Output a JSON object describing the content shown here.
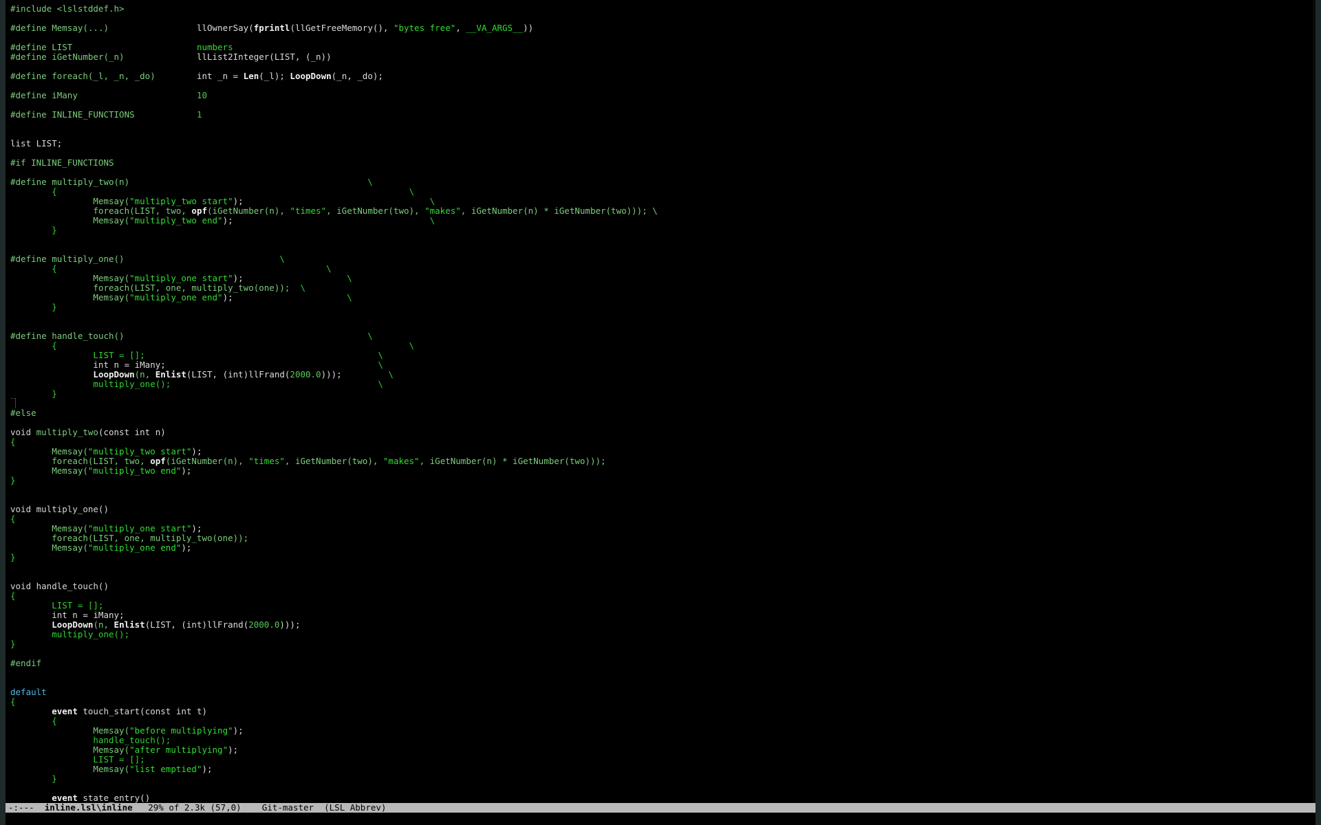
{
  "editor": {
    "lines": [
      [
        {
          "t": "#include <lslstddef.h>",
          "c": "preproc"
        }
      ],
      [],
      [
        {
          "t": "#define ",
          "c": "preproc"
        },
        {
          "t": "Memsay(...)",
          "c": "func"
        },
        {
          "t": "                 ",
          "c": "plain"
        },
        {
          "t": "llOwnerSay(",
          "c": "ident"
        },
        {
          "t": "fprintl",
          "c": "bold"
        },
        {
          "t": "(llGetFreeMemory(), ",
          "c": "ident"
        },
        {
          "t": "\"bytes free\"",
          "c": "string"
        },
        {
          "t": ", ",
          "c": "ident"
        },
        {
          "t": "__VA_ARGS__",
          "c": "string"
        },
        {
          "t": "))",
          "c": "ident"
        }
      ],
      [],
      [
        {
          "t": "#define ",
          "c": "preproc"
        },
        {
          "t": "LIST",
          "c": "func"
        },
        {
          "t": "                        ",
          "c": "plain"
        },
        {
          "t": "numbers",
          "c": "string"
        }
      ],
      [
        {
          "t": "#define ",
          "c": "preproc"
        },
        {
          "t": "iGetNumber(_n)",
          "c": "func"
        },
        {
          "t": "              ",
          "c": "plain"
        },
        {
          "t": "llList2Integer(LIST, (_n))",
          "c": "ident"
        }
      ],
      [],
      [
        {
          "t": "#define ",
          "c": "preproc"
        },
        {
          "t": "foreach(_l, _n, _do)",
          "c": "func"
        },
        {
          "t": "        ",
          "c": "plain"
        },
        {
          "t": "int _n = ",
          "c": "ident"
        },
        {
          "t": "Len",
          "c": "bold"
        },
        {
          "t": "(_l); ",
          "c": "ident"
        },
        {
          "t": "LoopDown",
          "c": "bold"
        },
        {
          "t": "(_n, _do);",
          "c": "ident"
        }
      ],
      [],
      [
        {
          "t": "#define ",
          "c": "preproc"
        },
        {
          "t": "iMany",
          "c": "func"
        },
        {
          "t": "                       ",
          "c": "plain"
        },
        {
          "t": "10",
          "c": "number"
        }
      ],
      [],
      [
        {
          "t": "#define ",
          "c": "preproc"
        },
        {
          "t": "INLINE_FUNCTIONS",
          "c": "func"
        },
        {
          "t": "            ",
          "c": "plain"
        },
        {
          "t": "1",
          "c": "number"
        }
      ],
      [],
      [],
      [
        {
          "t": "list LIST;",
          "c": "ident"
        }
      ],
      [],
      [
        {
          "t": "#if INLINE_FUNCTIONS",
          "c": "preproc"
        }
      ],
      [],
      [
        {
          "t": "#define ",
          "c": "preproc"
        },
        {
          "t": "multiply_two(n)",
          "c": "func"
        },
        {
          "t": "                                              \\",
          "c": "plain"
        }
      ],
      [
        {
          "t": "        {                                                                    \\",
          "c": "plain"
        }
      ],
      [
        {
          "t": "                ",
          "c": "plain"
        },
        {
          "t": "Memsay(",
          "c": "func"
        },
        {
          "t": "\"multiply_two start\"",
          "c": "string"
        },
        {
          "t": ");",
          "c": "ident"
        },
        {
          "t": "                                    \\",
          "c": "plain"
        }
      ],
      [
        {
          "t": "                ",
          "c": "plain"
        },
        {
          "t": "foreach(LIST, two, ",
          "c": "func"
        },
        {
          "t": "opf",
          "c": "bold"
        },
        {
          "t": "(iGetNumber(n), ",
          "c": "func"
        },
        {
          "t": "\"times\"",
          "c": "string"
        },
        {
          "t": ", iGetNumber(two), ",
          "c": "func"
        },
        {
          "t": "\"makes\"",
          "c": "string"
        },
        {
          "t": ", iGetNumber(n) * iGetNumber(two))); \\",
          "c": "func"
        }
      ],
      [
        {
          "t": "                ",
          "c": "plain"
        },
        {
          "t": "Memsay(",
          "c": "func"
        },
        {
          "t": "\"multiply_two end\"",
          "c": "string"
        },
        {
          "t": ");",
          "c": "ident"
        },
        {
          "t": "                                      \\",
          "c": "plain"
        }
      ],
      [
        {
          "t": "        }",
          "c": "plain"
        }
      ],
      [],
      [],
      [
        {
          "t": "#define ",
          "c": "preproc"
        },
        {
          "t": "multiply_one()",
          "c": "func"
        },
        {
          "t": "                              \\",
          "c": "plain"
        }
      ],
      [
        {
          "t": "        {                                                    \\",
          "c": "plain"
        }
      ],
      [
        {
          "t": "                ",
          "c": "plain"
        },
        {
          "t": "Memsay(",
          "c": "func"
        },
        {
          "t": "\"multiply_one start\"",
          "c": "string"
        },
        {
          "t": ");",
          "c": "ident"
        },
        {
          "t": "                    \\",
          "c": "plain"
        }
      ],
      [
        {
          "t": "                ",
          "c": "plain"
        },
        {
          "t": "foreach(LIST, one, multiply_two(one));",
          "c": "func"
        },
        {
          "t": "  \\",
          "c": "plain"
        }
      ],
      [
        {
          "t": "                ",
          "c": "plain"
        },
        {
          "t": "Memsay(",
          "c": "func"
        },
        {
          "t": "\"multiply_one end\"",
          "c": "string"
        },
        {
          "t": ");",
          "c": "ident"
        },
        {
          "t": "                      \\",
          "c": "plain"
        }
      ],
      [
        {
          "t": "        }",
          "c": "plain"
        }
      ],
      [],
      [],
      [
        {
          "t": "#define ",
          "c": "preproc"
        },
        {
          "t": "handle_touch()",
          "c": "func"
        },
        {
          "t": "                                               \\",
          "c": "plain"
        }
      ],
      [
        {
          "t": "        {                                                                    \\",
          "c": "plain"
        }
      ],
      [
        {
          "t": "                LIST = [];",
          "c": "plain"
        },
        {
          "t": "                                             \\",
          "c": "plain"
        }
      ],
      [
        {
          "t": "                int n = iMany;",
          "c": "ident"
        },
        {
          "t": "                                         \\",
          "c": "plain"
        }
      ],
      [
        {
          "t": "                ",
          "c": "plain"
        },
        {
          "t": "LoopDown",
          "c": "bold"
        },
        {
          "t": "(n, ",
          "c": "func"
        },
        {
          "t": "Enlist",
          "c": "bold"
        },
        {
          "t": "(LIST, (int)llFrand(",
          "c": "ident"
        },
        {
          "t": "2000.0",
          "c": "number"
        },
        {
          "t": ")));",
          "c": "ident"
        },
        {
          "t": "         \\",
          "c": "plain"
        }
      ],
      [
        {
          "t": "                multiply_one();",
          "c": "plain"
        },
        {
          "t": "                                        \\",
          "c": "plain"
        }
      ],
      [
        {
          "t": "        }",
          "c": "plain"
        }
      ],
      [
        {
          "t": "█",
          "c": "cursor"
        }
      ],
      [
        {
          "t": "#else",
          "c": "preproc"
        }
      ],
      [],
      [
        {
          "t": "void ",
          "c": "type"
        },
        {
          "t": "multiply_two",
          "c": "func"
        },
        {
          "t": "(const int n)",
          "c": "ident"
        }
      ],
      [
        {
          "t": "{",
          "c": "plain"
        }
      ],
      [
        {
          "t": "        ",
          "c": "plain"
        },
        {
          "t": "Memsay(",
          "c": "func"
        },
        {
          "t": "\"multiply_two start\"",
          "c": "string"
        },
        {
          "t": ");",
          "c": "ident"
        }
      ],
      [
        {
          "t": "        ",
          "c": "plain"
        },
        {
          "t": "foreach(LIST, two, ",
          "c": "func"
        },
        {
          "t": "opf",
          "c": "bold"
        },
        {
          "t": "(iGetNumber(n), ",
          "c": "func"
        },
        {
          "t": "\"times\"",
          "c": "string"
        },
        {
          "t": ", iGetNumber(two), ",
          "c": "func"
        },
        {
          "t": "\"makes\"",
          "c": "string"
        },
        {
          "t": ", iGetNumber(n) * iGetNumber(two)));",
          "c": "func"
        }
      ],
      [
        {
          "t": "        ",
          "c": "plain"
        },
        {
          "t": "Memsay(",
          "c": "func"
        },
        {
          "t": "\"multiply_two end\"",
          "c": "string"
        },
        {
          "t": ");",
          "c": "ident"
        }
      ],
      [
        {
          "t": "}",
          "c": "plain"
        }
      ],
      [],
      [],
      [
        {
          "t": "void multiply_one()",
          "c": "type"
        }
      ],
      [
        {
          "t": "{",
          "c": "plain"
        }
      ],
      [
        {
          "t": "        ",
          "c": "plain"
        },
        {
          "t": "Memsay(",
          "c": "func"
        },
        {
          "t": "\"multiply_one start\"",
          "c": "string"
        },
        {
          "t": ");",
          "c": "ident"
        }
      ],
      [
        {
          "t": "        ",
          "c": "plain"
        },
        {
          "t": "foreach(LIST, one, multiply_two(one));",
          "c": "func"
        }
      ],
      [
        {
          "t": "        ",
          "c": "plain"
        },
        {
          "t": "Memsay(",
          "c": "func"
        },
        {
          "t": "\"multiply_one end\"",
          "c": "string"
        },
        {
          "t": ");",
          "c": "ident"
        }
      ],
      [
        {
          "t": "}",
          "c": "plain"
        }
      ],
      [],
      [],
      [
        {
          "t": "void handle_touch()",
          "c": "type"
        }
      ],
      [
        {
          "t": "{",
          "c": "plain"
        }
      ],
      [
        {
          "t": "        LIST = [];",
          "c": "plain"
        }
      ],
      [
        {
          "t": "        int n = iMany;",
          "c": "ident"
        }
      ],
      [
        {
          "t": "        ",
          "c": "plain"
        },
        {
          "t": "LoopDown",
          "c": "bold"
        },
        {
          "t": "(n, ",
          "c": "func"
        },
        {
          "t": "Enlist",
          "c": "bold"
        },
        {
          "t": "(LIST, (int)llFrand(",
          "c": "ident"
        },
        {
          "t": "2000.0",
          "c": "number"
        },
        {
          "t": ")));",
          "c": "ident"
        }
      ],
      [
        {
          "t": "        multiply_one();",
          "c": "plain"
        }
      ],
      [
        {
          "t": "}",
          "c": "plain"
        }
      ],
      [],
      [
        {
          "t": "#endif",
          "c": "preproc"
        }
      ],
      [],
      [],
      [
        {
          "t": "default",
          "c": "special"
        }
      ],
      [
        {
          "t": "{",
          "c": "plain"
        }
      ],
      [
        {
          "t": "        ",
          "c": "plain"
        },
        {
          "t": "event",
          "c": "keyword"
        },
        {
          "t": " touch_start(const int t)",
          "c": "ident"
        }
      ],
      [
        {
          "t": "        {",
          "c": "plain"
        }
      ],
      [
        {
          "t": "                ",
          "c": "plain"
        },
        {
          "t": "Memsay(",
          "c": "func"
        },
        {
          "t": "\"before multiplying\"",
          "c": "string"
        },
        {
          "t": ");",
          "c": "ident"
        }
      ],
      [
        {
          "t": "                handle_touch();",
          "c": "plain"
        }
      ],
      [
        {
          "t": "                ",
          "c": "plain"
        },
        {
          "t": "Memsay(",
          "c": "func"
        },
        {
          "t": "\"after multiplying\"",
          "c": "string"
        },
        {
          "t": ");",
          "c": "ident"
        }
      ],
      [
        {
          "t": "                LIST = [];",
          "c": "plain"
        }
      ],
      [
        {
          "t": "                ",
          "c": "plain"
        },
        {
          "t": "Memsay(",
          "c": "func"
        },
        {
          "t": "\"list emptied\"",
          "c": "string"
        },
        {
          "t": ");",
          "c": "ident"
        }
      ],
      [
        {
          "t": "        }",
          "c": "plain"
        }
      ],
      [],
      [
        {
          "t": "        ",
          "c": "plain"
        },
        {
          "t": "event",
          "c": "keyword"
        },
        {
          "t": " state_entry()",
          "c": "ident"
        }
      ]
    ]
  },
  "modeline": {
    "status": "-:---",
    "buffer": "inline.lsl\\inline",
    "position": "29% of 2.3k (57,0)",
    "vcs": "Git-master",
    "modes": "(LSL Abbrev)"
  }
}
